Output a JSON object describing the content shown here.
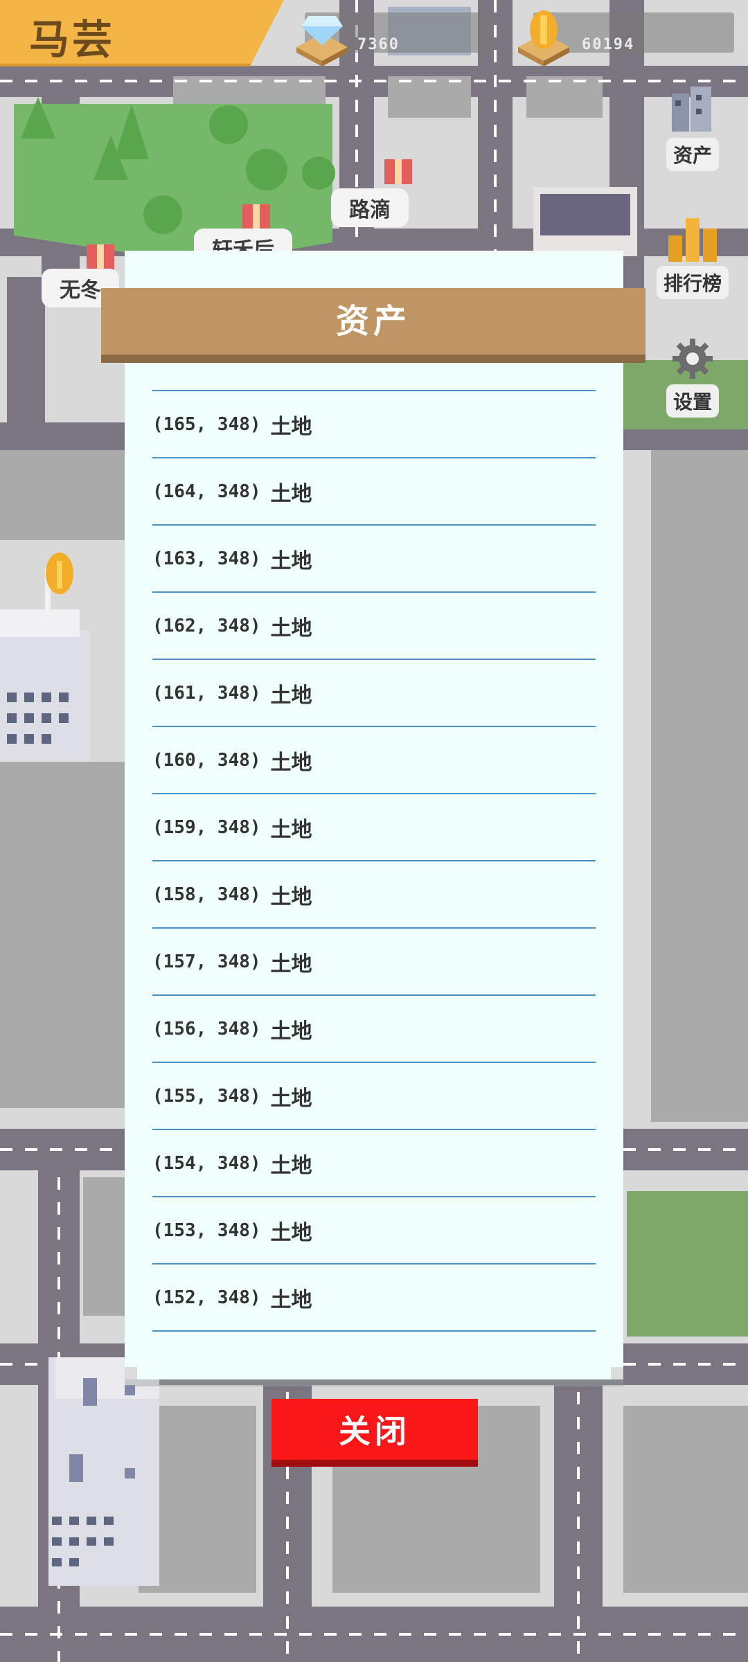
{
  "player": {
    "name": "马芸"
  },
  "resources": {
    "gems": "7360",
    "coins": "60194"
  },
  "side_menu": {
    "assets_label": "资产",
    "leaderboard_label": "排行榜",
    "settings_label": "设置"
  },
  "map_labels": {
    "label_1": "路滴",
    "label_2": "轩禾后",
    "label_3": "无冬"
  },
  "modal": {
    "title": "资产",
    "close_label": "关闭",
    "items": [
      {
        "coord": "(165, 348)",
        "type": "土地"
      },
      {
        "coord": "(164, 348)",
        "type": "土地"
      },
      {
        "coord": "(163, 348)",
        "type": "土地"
      },
      {
        "coord": "(162, 348)",
        "type": "土地"
      },
      {
        "coord": "(161, 348)",
        "type": "土地"
      },
      {
        "coord": "(160, 348)",
        "type": "土地"
      },
      {
        "coord": "(159, 348)",
        "type": "土地"
      },
      {
        "coord": "(158, 348)",
        "type": "土地"
      },
      {
        "coord": "(157, 348)",
        "type": "土地"
      },
      {
        "coord": "(156, 348)",
        "type": "土地"
      },
      {
        "coord": "(155, 348)",
        "type": "土地"
      },
      {
        "coord": "(154, 348)",
        "type": "土地"
      },
      {
        "coord": "(153, 348)",
        "type": "土地"
      },
      {
        "coord": "(152, 348)",
        "type": "土地"
      }
    ]
  }
}
